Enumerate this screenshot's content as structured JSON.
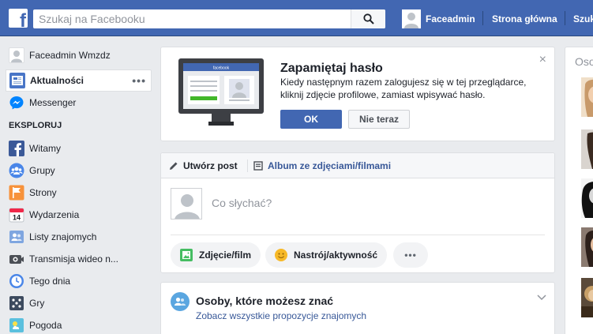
{
  "topbar": {
    "logo_letter": "f",
    "search_placeholder": "Szukaj na Facebooku",
    "user_name": "Faceadmin",
    "home_link": "Strona główna",
    "find_link": "Szuk"
  },
  "leftnav": {
    "profile_name": "Faceadmin Wmzdz",
    "items": [
      {
        "label": "Aktualności",
        "icon": "news-feed-icon",
        "active": true
      },
      {
        "label": "Messenger",
        "icon": "messenger-icon"
      }
    ],
    "explore_heading": "EKSPLORUJ",
    "explore": [
      {
        "label": "Witamy",
        "icon": "facebook-welcome-icon"
      },
      {
        "label": "Grupy",
        "icon": "groups-icon"
      },
      {
        "label": "Strony",
        "icon": "pages-flag-icon"
      },
      {
        "label": "Wydarzenia",
        "icon": "calendar-icon",
        "day": "14"
      },
      {
        "label": "Listy znajomych",
        "icon": "friend-lists-icon"
      },
      {
        "label": "Transmisja wideo n...",
        "icon": "live-video-icon"
      },
      {
        "label": "Tego dnia",
        "icon": "on-this-day-icon"
      },
      {
        "label": "Gry",
        "icon": "games-icon"
      },
      {
        "label": "Pogoda",
        "icon": "weather-icon"
      }
    ],
    "more_dots": "•••"
  },
  "password_card": {
    "title": "Zapamiętaj hasło",
    "text": "Kiedy następnym razem zalogujesz się w tej przeglądarce, kliknij zdjęcie profilowe, zamiast wpisywać hasło.",
    "ok_label": "OK",
    "later_label": "Nie teraz",
    "close_glyph": "×",
    "illustration_brand": "facebook"
  },
  "composer": {
    "tab_create": "Utwórz post",
    "tab_album": "Album ze zdjęciami/filmami",
    "placeholder": "Co słychać?",
    "photo_label": "Zdjęcie/film",
    "mood_label": "Nastrój/aktywność",
    "more_dots": "•••"
  },
  "pymk": {
    "title": "Osoby, które możesz znać",
    "link": "Zobacz wszystkie propozycje znajomych"
  },
  "rightcol": {
    "title": "Osoby"
  },
  "colors": {
    "brand_blue": "#4267b2",
    "link_blue": "#385898",
    "page_bg": "#e9ebee"
  }
}
